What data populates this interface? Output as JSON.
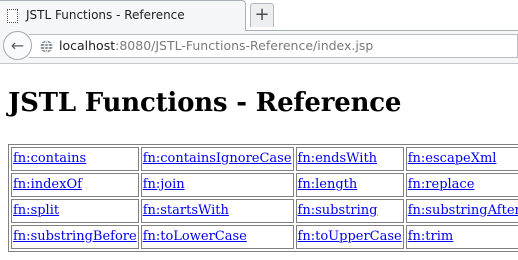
{
  "browser": {
    "tab": {
      "title": "JSTL Functions - Reference",
      "favicon": "blank-page-icon"
    },
    "new_tab": {
      "label": "+"
    },
    "back_button": {
      "icon": "back-arrow-icon",
      "glyph": "←"
    },
    "address_bar": {
      "host": "localhost",
      "rest": ":8080/JSTL-Functions-Reference/index.jsp",
      "icon": "globe-icon"
    }
  },
  "page": {
    "heading": "JSTL Functions - Reference",
    "table": {
      "rows": [
        [
          "fn:contains",
          "fn:containsIgnoreCase",
          "fn:endsWith",
          "fn:escapeXml"
        ],
        [
          "fn:indexOf",
          "fn:join",
          "fn:length",
          "fn:replace"
        ],
        [
          "fn:split",
          "fn:startsWith",
          "fn:substring",
          "fn:substringAfter"
        ],
        [
          "fn:substringBefore",
          "fn:toLowerCase",
          "fn:toUpperCase",
          "fn:trim"
        ]
      ]
    }
  },
  "colors": {
    "link": "#0000ee",
    "chrome": "#f5f6f7",
    "border": "#808080"
  }
}
